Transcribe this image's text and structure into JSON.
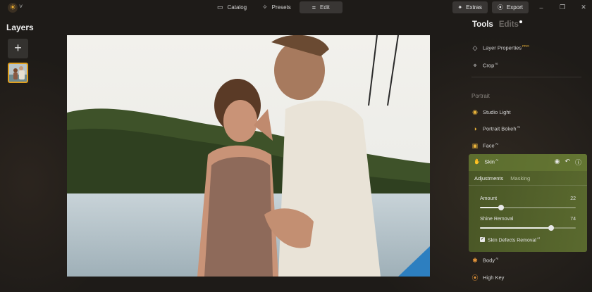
{
  "app": {
    "logo_icon": "sun-logo-icon"
  },
  "nav": {
    "catalog": "Catalog",
    "presets": "Presets",
    "edit": "Edit"
  },
  "topright": {
    "extras": "Extras",
    "export": "Export"
  },
  "layers": {
    "title": "Layers",
    "add_label": "+"
  },
  "tabs": {
    "tools": "Tools",
    "edits": "Edits"
  },
  "tools_top": [
    {
      "label": "Layer Properties",
      "badge": "PRO",
      "icon": "layers-icon"
    },
    {
      "label": "Crop",
      "badge": "AI",
      "icon": "crop-icon"
    }
  ],
  "portrait": {
    "section": "Portrait",
    "items": [
      {
        "label": "Studio Light",
        "badge": "",
        "icon": "studio-light-icon"
      },
      {
        "label": "Portrait Bokeh",
        "badge": "AI",
        "icon": "bokeh-icon"
      },
      {
        "label": "Face",
        "badge": "AI",
        "icon": "face-icon"
      }
    ]
  },
  "skin": {
    "title": "Skin",
    "badge": "AI",
    "tab_adjustments": "Adjustments",
    "tab_masking": "Masking",
    "amount_label": "Amount",
    "amount_value": "22",
    "amount_fraction": 0.22,
    "shine_label": "Shine Removal",
    "shine_value": "74",
    "shine_fraction": 0.74,
    "defects_label": "Skin Defects Removal",
    "defects_badge": "AI",
    "defects_checked": true
  },
  "bottom_items": [
    {
      "label": "Body",
      "badge": "AI",
      "icon": "body-icon"
    },
    {
      "label": "High Key",
      "badge": "",
      "icon": "high-key-icon"
    }
  ],
  "colors": {
    "accent": "#e0a020",
    "skin_panel": "#5b6d2c"
  }
}
